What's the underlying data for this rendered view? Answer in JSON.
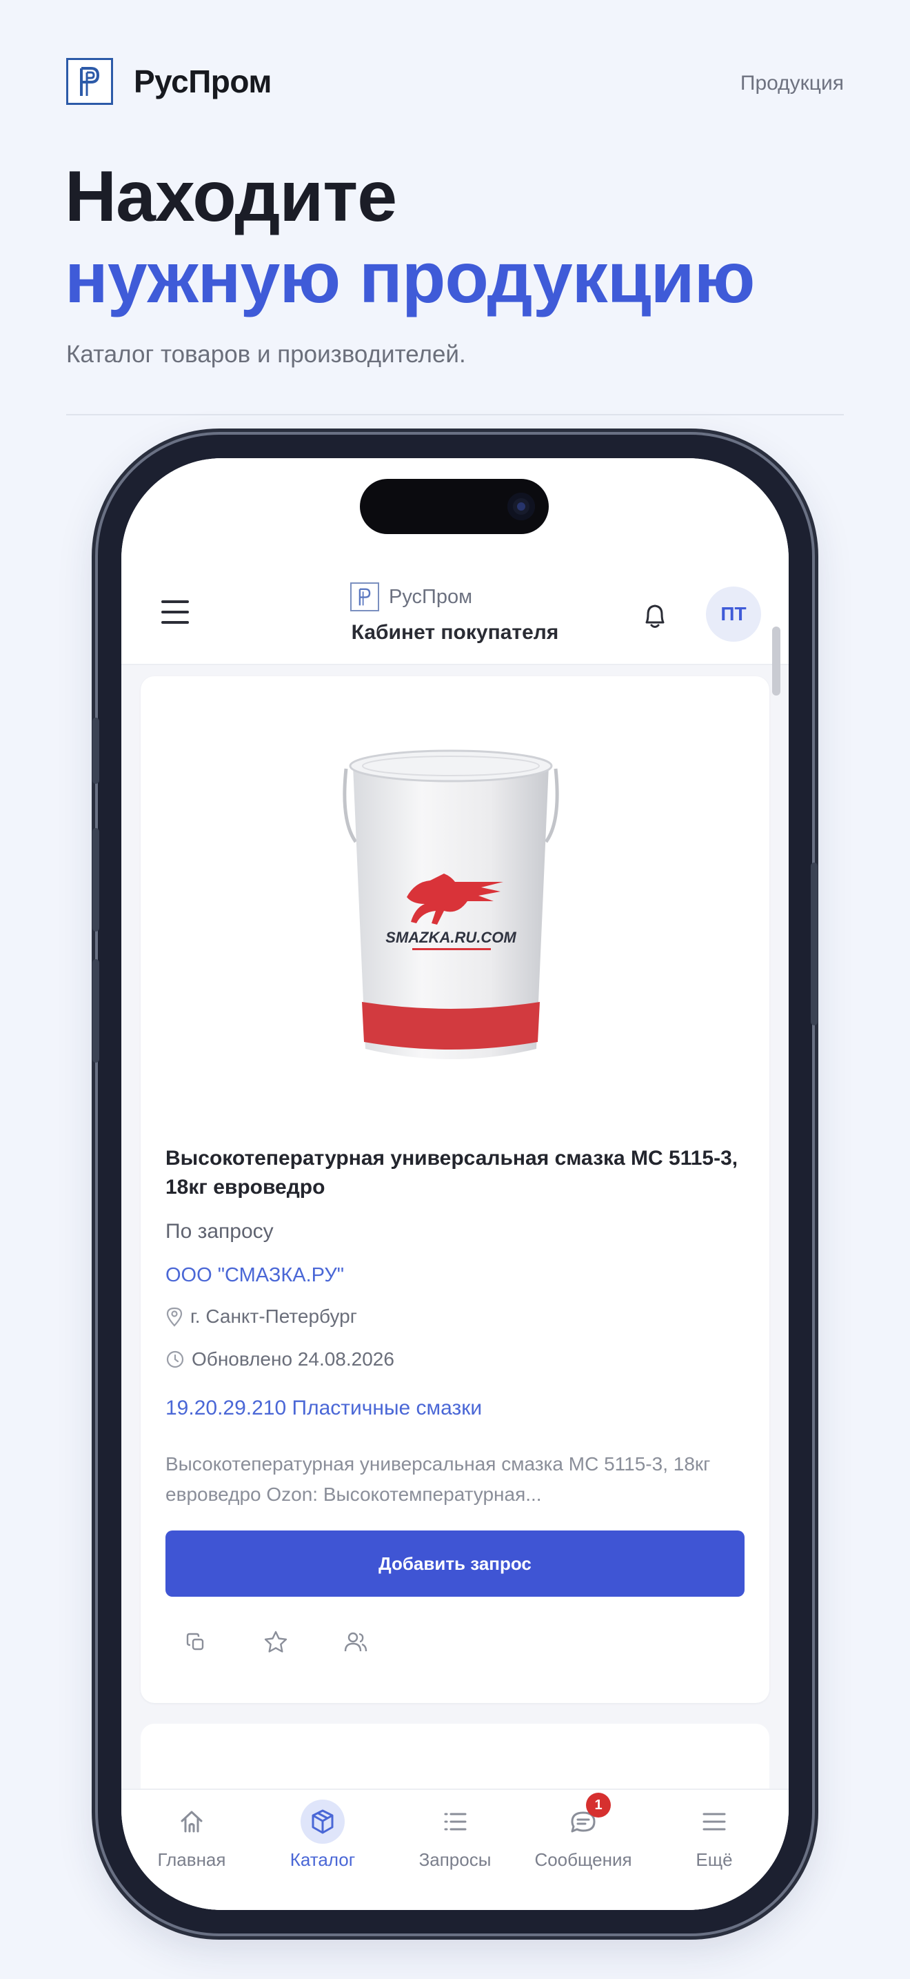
{
  "page": {
    "brand_name": "РусПром",
    "top_link": "Продукция",
    "hero_line1": "Находите",
    "hero_line2": "нужную продукцию",
    "subtitle": "Каталог товаров и производителей."
  },
  "app": {
    "logo_text": "РусПром",
    "title": "Кабинет покупателя",
    "avatar_initials": "ПТ"
  },
  "product": {
    "title": "Высокотепературная универсальная смазка МС 5115-3, 18кг евроведро",
    "price": "По запросу",
    "company": "ООО \"СМАЗКА.РУ\"",
    "location": "г. Санкт-Петербург",
    "updated": "Обновлено 24.08.2026",
    "category": "19.20.29.210 Пластичные смазки",
    "description": "Высокотепературная универсальная смазка МС 5115-3, 18кг евроведро Ozon: Высокотемпературная...",
    "button_label": "Добавить запрос",
    "bucket_brand": "SMAZKA.RU.COM"
  },
  "nav": {
    "items": [
      {
        "label": "Главная",
        "icon": "home-icon"
      },
      {
        "label": "Каталог",
        "icon": "box-icon"
      },
      {
        "label": "Запросы",
        "icon": "list-icon"
      },
      {
        "label": "Сообщения",
        "icon": "chat-icon",
        "badge": "1"
      },
      {
        "label": "Ещё",
        "icon": "menu-icon"
      }
    ],
    "active": "Каталог"
  },
  "colors": {
    "accent": "#3f5bd8",
    "button": "#3f55d4",
    "badge": "#d6302f",
    "background": "#f2f5fc"
  }
}
